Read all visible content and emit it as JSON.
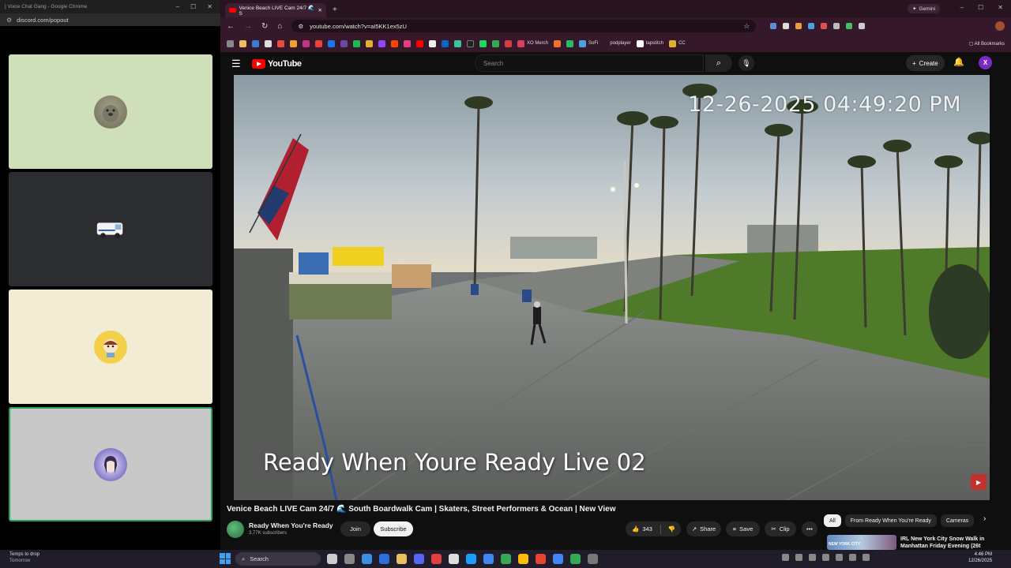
{
  "discord": {
    "window_title": "| Voice Chat Gang - Google Chrome",
    "url": "discord.com/popout",
    "tiles": [
      {
        "bg": "#cfdfb9",
        "avatar_icon": "seal-avatar-icon",
        "border": "none"
      },
      {
        "bg": "#2b2d31",
        "avatar_icon": "van-avatar-icon",
        "border": "none"
      },
      {
        "bg": "#f3ecd4",
        "avatar_icon": "cartoon-avatar-icon",
        "border": "none"
      },
      {
        "bg": "#c8c8c8",
        "avatar_icon": "girl-avatar-icon",
        "border": "#23a55a"
      }
    ]
  },
  "chrome": {
    "tab_title": "Venice Beach LIVE Cam 24/7 🌊 S",
    "new_tab_symbol": "+",
    "gemini_label": "Gemini",
    "url": "youtube.com/watch?v=aI5KK1ex5zU",
    "bookmarks": [
      {
        "label": "XO Merch",
        "color": "#d84060"
      },
      {
        "label": "SoFi",
        "color": "#4aa0e0"
      },
      {
        "label": "podplayer",
        "color": "#6a4aa0"
      },
      {
        "label": "tapstitch",
        "color": "#ffffff"
      },
      {
        "label": "CC",
        "color": "#e0b030"
      }
    ],
    "all_bookmarks": "All Bookmarks"
  },
  "youtube": {
    "logo_text": "YouTube",
    "search_placeholder": "Search",
    "create_label": "Create",
    "avatar_letter": "X",
    "cam_timestamp": "12-26-2025 04:49:20 PM",
    "cam_caption": "Ready When Youre Ready Live 02",
    "video_title": "Venice Beach LIVE Cam 24/7 🌊 South Boardwalk Cam | Skaters, Street Performers & Ocean | New View",
    "channel_name": "Ready When You're Ready",
    "channel_subs": "3.77K subscribers",
    "join_label": "Join",
    "subscribe_label": "Subscribe",
    "like_count": "343",
    "share_label": "Share",
    "save_label": "Save",
    "clip_label": "Clip",
    "more_label": "•••",
    "chips": [
      "All",
      "From Ready When You're Ready",
      "Cameras"
    ],
    "rec_thumb_label": "NEW YORK CITY",
    "rec_title": "IRL New York City Snow Walk in Manhattan Friday Evening (26t"
  },
  "taskbar": {
    "weather_line1": "Temps to drop",
    "weather_line2": "Tomorrow",
    "search_label": "Search",
    "time": "4:46 PM",
    "date": "12/26/2025"
  },
  "colors": {
    "chrome_frame": "#35192b",
    "yt_red": "#ff0000",
    "accent_green": "#23a55a"
  }
}
